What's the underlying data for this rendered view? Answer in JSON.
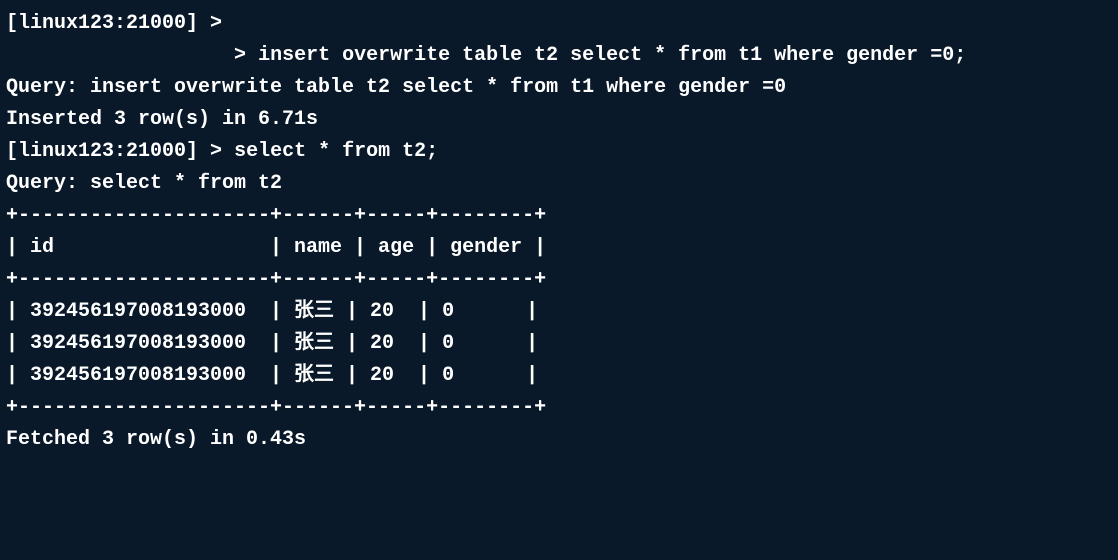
{
  "terminal": {
    "prompt": "[linux123:21000] >",
    "continuation_prompt": ">",
    "command1": "insert overwrite table t2 select * from t1 where gender =0;",
    "query_echo1": "Query: insert overwrite table t2 select * from t1 where gender =0",
    "insert_result": "Inserted 3 row(s) in 6.71s",
    "command2": "select * from t2;",
    "query_echo2": "Query: select * from t2",
    "table": {
      "border_top": "+---------------------+------+-----+--------+",
      "header": "| id                  | name | age | gender |",
      "border_mid": "+---------------------+------+-----+--------+",
      "rows": [
        "| 392456197008193000  | 张三 | 20  | 0      |",
        "| 392456197008193000  | 张三 | 20  | 0      |",
        "| 392456197008193000  | 张三 | 20  | 0      |"
      ],
      "border_bottom": "+---------------------+------+-----+--------+"
    },
    "fetch_result": "Fetched 3 row(s) in 0.43s"
  },
  "chart_data": {
    "type": "table",
    "columns": [
      "id",
      "name",
      "age",
      "gender"
    ],
    "rows": [
      {
        "id": "392456197008193000",
        "name": "张三",
        "age": 20,
        "gender": 0
      },
      {
        "id": "392456197008193000",
        "name": "张三",
        "age": 20,
        "gender": 0
      },
      {
        "id": "392456197008193000",
        "name": "张三",
        "age": 20,
        "gender": 0
      }
    ]
  }
}
